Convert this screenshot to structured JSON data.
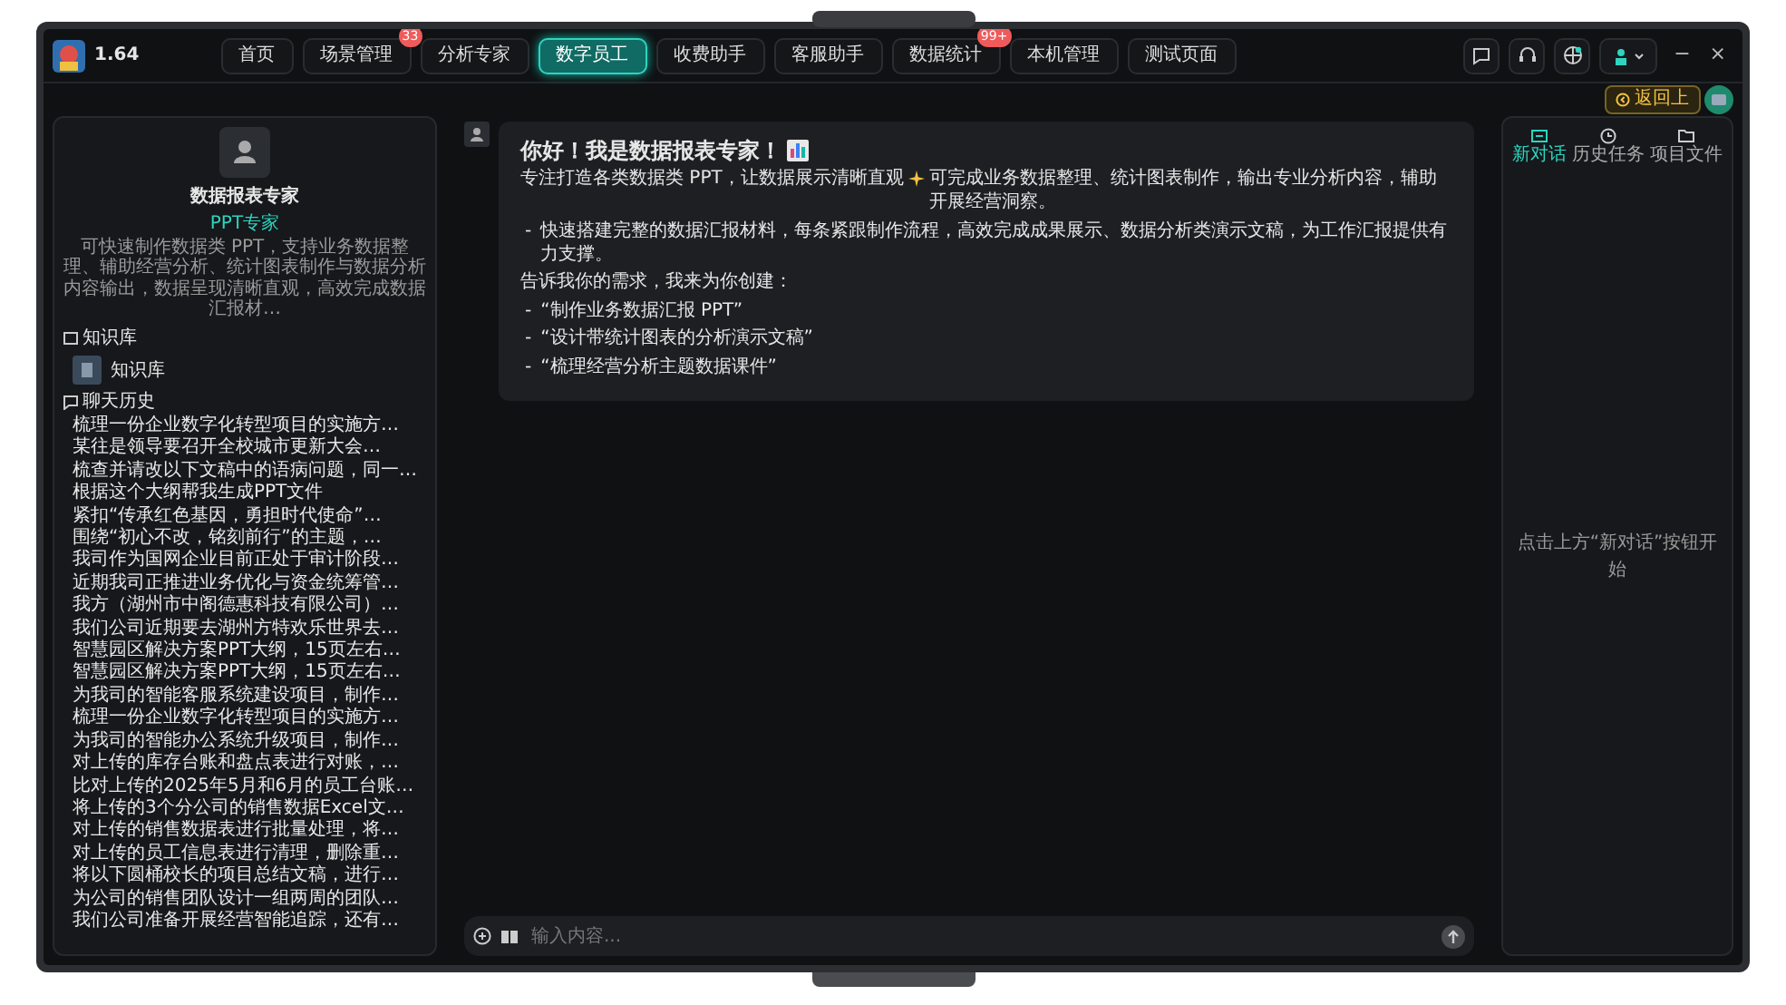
{
  "app": {
    "version": "1.64"
  },
  "nav_tabs": [
    {
      "label": "首页",
      "selected": false
    },
    {
      "label": "场景管理",
      "selected": false,
      "badge": "33"
    },
    {
      "label": "分析专家",
      "selected": false
    },
    {
      "label": "数字员工",
      "selected": true
    },
    {
      "label": "收费助手",
      "selected": false
    },
    {
      "label": "客服助手",
      "selected": false
    },
    {
      "label": "数据统计",
      "selected": false,
      "badge": "99+"
    },
    {
      "label": "本机管理",
      "selected": false
    },
    {
      "label": "测试页面",
      "selected": false
    }
  ],
  "window_controls": [
    "−",
    "×"
  ],
  "back_button": {
    "label": "返回上"
  },
  "assistant": {
    "name": "数据报表专家",
    "role": "PPT专家",
    "description": "可快速制作数据类 PPT，支持业务数据整理、辅助经营分析、统计图表制作与数据分析内容输出，数据呈现清晰直观，高效完成数据汇报材…"
  },
  "knowledge": {
    "heading": "知识库",
    "items": [
      "知识库"
    ]
  },
  "history": {
    "heading": "聊天历史",
    "items": [
      "梳理一份企业数字化转型项目的实施方…",
      "某往是领导要召开全校城市更新大会…",
      "梳查并请改以下文稿中的语病问题，同一…",
      "根据这个大纲帮我生成PPT文件",
      "紧扣“传承红色基因，勇担时代使命”…",
      "围绕“初心不改，铭刻前行”的主题，…",
      "我司作为国网企业目前正处于审计阶段…",
      "近期我司正推进业务优化与资金统筹管…",
      "我方（湖州市中阁德惠科技有限公司）…",
      "我们公司近期要去湖州方特欢乐世界去…",
      "智慧园区解决方案PPT大纲，15页左右…",
      "智慧园区解决方案PPT大纲，15页左右…",
      "为我司的智能客服系统建设项目，制作…",
      "梳理一份企业数字化转型项目的实施方…",
      "为我司的智能办公系统升级项目，制作…",
      "对上传的库存台账和盘点表进行对账，…",
      "比对上传的2025年5月和6月的员工台账…",
      "将上传的3个分公司的销售数据Excel文…",
      "对上传的销售数据表进行批量处理，将…",
      "对上传的员工信息表进行清理，删除重…",
      "将以下圆桶校长的项目总结文稿，进行…",
      "为公司的销售团队设计一组两周的团队…",
      "我们公司准备开展经营智能追踪，还有…"
    ]
  },
  "message": {
    "title": "你好！我是数据报表专家！",
    "intro_before": "专注打造各类数据类 PPT，让数据展示清晰直观",
    "intro_after": "可完成业务数据整理、统计图表制作，输出专业分析内容，辅助开展经营洞察。",
    "points": [
      {
        "marker": "-",
        "text": "快速搭建完整的数据汇报材料，每条紧跟制作流程，高效完成成果展示、数据分析类演示文稿，为工作汇报提供有力支撑。"
      }
    ],
    "prompt": "告诉我你的需求，我来为你创建：",
    "examples": [
      {
        "marker": "-",
        "text": "“制作业务数据汇报 PPT”"
      },
      {
        "marker": "-",
        "text": "“设计带统计图表的分析演示文稿”"
      },
      {
        "marker": "-",
        "text": "“梳理经营分析主题数据课件”"
      }
    ]
  },
  "input": {
    "placeholder": "输入内容..."
  },
  "side_tabs": [
    {
      "label": "新对话",
      "selected": true,
      "kind": "chat"
    },
    {
      "label": "历史任务",
      "selected": false,
      "kind": "history"
    },
    {
      "label": "项目文件",
      "selected": false,
      "kind": "folder"
    }
  ],
  "side_hint": "点击上方“新对话”按钮开始"
}
